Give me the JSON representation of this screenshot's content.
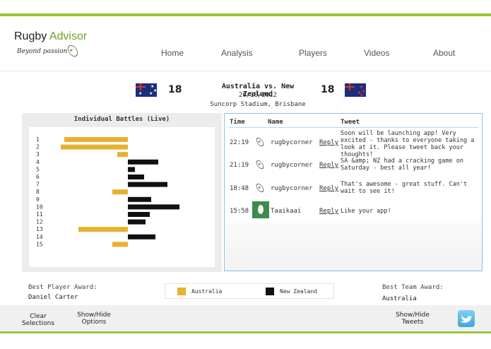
{
  "header": {
    "brand_first": "Rugby",
    "brand_second": "Advisor",
    "tagline": "Beyond passion",
    "nav": [
      "Home",
      "Analysis",
      "Players",
      "Videos",
      "About"
    ]
  },
  "match": {
    "title": "Australia vs. New Zealand",
    "date": "20/10/2012",
    "venue": "Suncorp Stadium, Brisbane",
    "home_score": "18",
    "away_score": "18"
  },
  "battles": {
    "title": "Individual Battles (Live)"
  },
  "chart_data": {
    "type": "bar",
    "orientation": "horizontal",
    "title": "Individual Battles (Live)",
    "categories": [
      "1",
      "2",
      "3",
      "4",
      "5",
      "6",
      "7",
      "8",
      "9",
      "10",
      "11",
      "12",
      "13",
      "14",
      "15"
    ],
    "series": [
      {
        "name": "Australia",
        "color": "#e6b133",
        "values": [
          -9,
          -9.5,
          -1.5,
          0,
          0,
          0,
          0,
          -2.2,
          0,
          0,
          0,
          0,
          -7,
          0,
          -2.2
        ]
      },
      {
        "name": "New Zealand",
        "color": "#111111",
        "values": [
          0,
          0,
          0,
          4.3,
          1,
          2.3,
          5.6,
          0,
          3.3,
          7.3,
          3.1,
          2.5,
          0,
          3.9,
          0
        ]
      }
    ],
    "xlim": [
      -10,
      8
    ],
    "grid": false,
    "legend": "bottom"
  },
  "tweets": {
    "headers": {
      "time": "Time",
      "name": "Name",
      "tweet": "Tweet"
    },
    "reply_label": "Reply",
    "rows": [
      {
        "time": "22:19",
        "avatar": "rugby-ball-icon",
        "name": "rugbycorner",
        "text": "Soon will be launching app! Very excited - thanks to everyone taking a look at it. Please tweet back your thoughts!"
      },
      {
        "time": "21:19",
        "avatar": "rugby-ball-icon",
        "name": "rugbycorner",
        "text": "SA &amp; NZ had a cracking game on Saturday - best all year!"
      },
      {
        "time": "18:48",
        "avatar": "rugby-ball-icon",
        "name": "rugbycorner",
        "text": "That's awesome - great stuff. Can't wait to see it!"
      },
      {
        "time": "15:58",
        "avatar": "user-avatar-icon",
        "name": "Taaikaai",
        "text": "Like your app!"
      }
    ]
  },
  "awards": {
    "best_player_label": "Best Player Award:",
    "best_player": "Daniel Carter",
    "best_team_label": "Best Team Award:",
    "best_team": "Australia"
  },
  "legend": {
    "australia": "Australia",
    "new_zealand": "New Zealand"
  },
  "footer": {
    "clear_line1": "Clear",
    "clear_line2": "Selections",
    "options_line1": "Show/Hide",
    "options_line2": "Options",
    "tweets_line1": "Show/Hide",
    "tweets_line2": "Tweets"
  },
  "colors": {
    "accent_green": "#9ac43a",
    "australia": "#e6b133",
    "new_zealand": "#111111",
    "tweet_border": "#8fc0e0"
  }
}
